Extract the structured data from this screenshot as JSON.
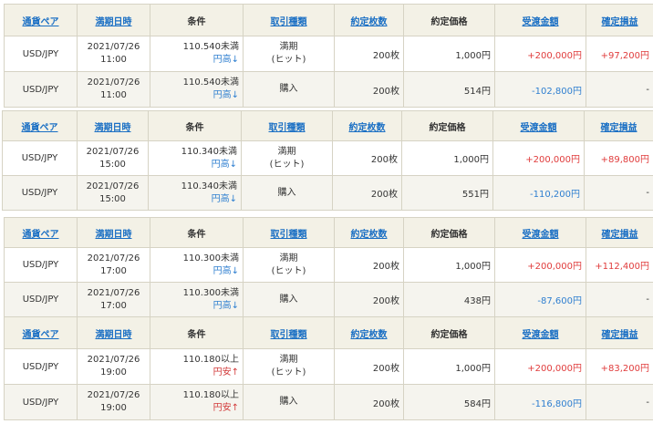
{
  "headers": {
    "pair": "通貨ペア",
    "expiry": "満期日時",
    "condition": "条件",
    "trade_type": "取引種類",
    "quantity": "約定枚数",
    "price": "約定価格",
    "settlement": "受渡金額",
    "profit": "確定損益"
  },
  "groups": [
    {
      "rows": [
        {
          "pair": "USD/JPY",
          "date": "2021/07/26",
          "time": "11:00",
          "cond_value": "110.540未満",
          "cond_dir": "円高↓",
          "type_line1": "満期",
          "type_line2": "(ヒット)",
          "qty": "200枚",
          "price": "1,000円",
          "settle": "+200,000円",
          "profit": "+97,200円"
        },
        {
          "pair": "USD/JPY",
          "date": "2021/07/26",
          "time": "11:00",
          "cond_value": "110.540未満",
          "cond_dir": "円高↓",
          "type_line1": "購入",
          "type_line2": "",
          "qty": "200枚",
          "price": "514円",
          "settle": "-102,800円",
          "profit": "-"
        }
      ]
    },
    {
      "rows": [
        {
          "pair": "USD/JPY",
          "date": "2021/07/26",
          "time": "15:00",
          "cond_value": "110.340未満",
          "cond_dir": "円高↓",
          "type_line1": "満期",
          "type_line2": "(ヒット)",
          "qty": "200枚",
          "price": "1,000円",
          "settle": "+200,000円",
          "profit": "+89,800円"
        },
        {
          "pair": "USD/JPY",
          "date": "2021/07/26",
          "time": "15:00",
          "cond_value": "110.340未満",
          "cond_dir": "円高↓",
          "type_line1": "購入",
          "type_line2": "",
          "qty": "200枚",
          "price": "551円",
          "settle": "-110,200円",
          "profit": "-"
        }
      ]
    },
    {
      "rows": [
        {
          "pair": "USD/JPY",
          "date": "2021/07/26",
          "time": "17:00",
          "cond_value": "110.300未満",
          "cond_dir": "円高↓",
          "type_line1": "満期",
          "type_line2": "(ヒット)",
          "qty": "200枚",
          "price": "1,000円",
          "settle": "+200,000円",
          "profit": "+112,400円"
        },
        {
          "pair": "USD/JPY",
          "date": "2021/07/26",
          "time": "17:00",
          "cond_value": "110.300未満",
          "cond_dir": "円高↓",
          "type_line1": "購入",
          "type_line2": "",
          "qty": "200枚",
          "price": "438円",
          "settle": "-87,600円",
          "profit": "-"
        }
      ]
    },
    {
      "rows": [
        {
          "pair": "USD/JPY",
          "date": "2021/07/26",
          "time": "19:00",
          "cond_value": "110.180以上",
          "cond_dir": "円安↑",
          "type_line1": "満期",
          "type_line2": "(ヒット)",
          "qty": "200枚",
          "price": "1,000円",
          "settle": "+200,000円",
          "profit": "+83,200円"
        },
        {
          "pair": "USD/JPY",
          "date": "2021/07/26",
          "time": "19:00",
          "cond_value": "110.180以上",
          "cond_dir": "円安↑",
          "type_line1": "購入",
          "type_line2": "",
          "qty": "200枚",
          "price": "584円",
          "settle": "-116,800円",
          "profit": "-"
        }
      ]
    }
  ],
  "colors": {
    "link": "#1a6fc4",
    "positive": "#e03c3c",
    "negative": "#2f7fd0",
    "header_bg": "#f3f1e6",
    "alt_row_bg": "#f5f4ee",
    "border": "#d6d3c4"
  }
}
